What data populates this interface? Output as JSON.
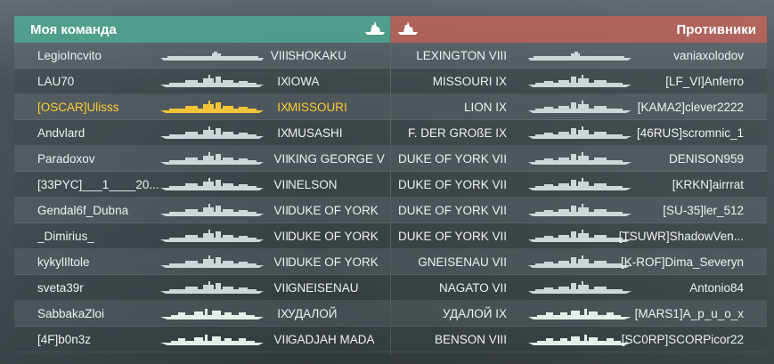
{
  "colors": {
    "ally_header": "#4eaf96",
    "enemy_header": "#cd6458",
    "self_highlight": "#ffcc33",
    "text": "#eef2f4"
  },
  "left": {
    "title": "Моя команда",
    "header_icon": "ship-silhouette-icon",
    "rows": [
      {
        "player": "LegioIncvito",
        "tier": "VIII",
        "ship": "SHOKAKU",
        "class": "carrier"
      },
      {
        "player": "LAU70",
        "tier": "IX",
        "ship": "IOWA",
        "class": "battleship"
      },
      {
        "player": "[OSCAR]Ulisss",
        "tier": "IX",
        "ship": "MISSOURI",
        "class": "battleship",
        "self": true
      },
      {
        "player": "Andvlard",
        "tier": "IX",
        "ship": "MUSASHI",
        "class": "battleship"
      },
      {
        "player": "Paradoxov",
        "tier": "VII",
        "ship": "KING GEORGE V",
        "class": "battleship"
      },
      {
        "player": "[33PYC]___1____20...",
        "tier": "VII",
        "ship": "NELSON",
        "class": "battleship"
      },
      {
        "player": "Gendal6f_Dubna",
        "tier": "VII",
        "ship": "DUKE OF YORK",
        "class": "battleship"
      },
      {
        "player": "_Dimirius_",
        "tier": "VII",
        "ship": "DUKE OF YORK",
        "class": "battleship"
      },
      {
        "player": "kykylIltole",
        "tier": "VII",
        "ship": "DUKE OF YORK",
        "class": "battleship"
      },
      {
        "player": "sveta39r",
        "tier": "VII",
        "ship": "GNEISENAU",
        "class": "battleship"
      },
      {
        "player": "SabbakaZloi",
        "tier": "IX",
        "ship": "УДАЛОЙ",
        "class": "destroyer"
      },
      {
        "player": "[4F]b0n3z",
        "tier": "VII",
        "ship": "GADJAH MADA",
        "class": "destroyer"
      }
    ]
  },
  "right": {
    "title": "Противники",
    "header_icon": "ship-silhouette-icon",
    "rows": [
      {
        "ship": "LEXINGTON VIII",
        "player": "vaniaxolodov",
        "class": "carrier"
      },
      {
        "ship": "MISSOURI IX",
        "player": "[LF_VI]Anferro",
        "class": "battleship"
      },
      {
        "ship": "LION IX",
        "player": "[KAMA2]clever2222",
        "class": "battleship"
      },
      {
        "ship": "F. DER GROßE IX",
        "player": "[46RUS]scromnic_1",
        "class": "battleship"
      },
      {
        "ship": "DUKE OF YORK VII",
        "player": "DENISON959",
        "class": "battleship"
      },
      {
        "ship": "DUKE OF YORK VII",
        "player": "[KRKN]airrrat",
        "class": "battleship"
      },
      {
        "ship": "DUKE OF YORK VII",
        "player": "[SU-35]ler_512",
        "class": "battleship"
      },
      {
        "ship": "DUKE OF YORK VII",
        "player": "[TSUWR]ShadowVen...",
        "class": "battleship"
      },
      {
        "ship": "GNEISENAU VII",
        "player": "[K-ROF]Dima_Severyn",
        "class": "battleship"
      },
      {
        "ship": "NAGATO VII",
        "player": "Antonio84",
        "class": "battleship"
      },
      {
        "ship": "УДАЛОЙ IX",
        "player": "[MARS1]A_p_u_o_x",
        "class": "destroyer"
      },
      {
        "ship": "BENSON VIII",
        "player": "[SC0RP]SCORPicor22",
        "class": "destroyer"
      }
    ]
  }
}
